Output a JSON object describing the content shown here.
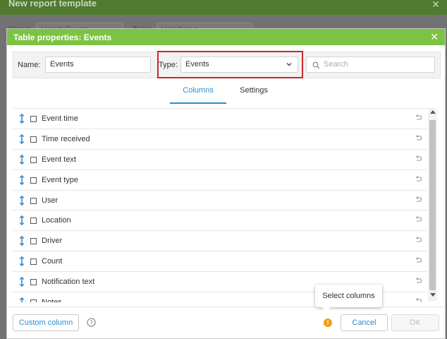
{
  "background_window": {
    "title": "New report template",
    "name_label": "Name:",
    "name_value": "Unsub Events",
    "type_label": "Type:",
    "type_value": "Unit Group"
  },
  "dialog": {
    "title": "Table properties: Events",
    "close_glyph": "✕"
  },
  "toolbar": {
    "name_label": "Name:",
    "name_value": "Events",
    "type_label": "Type:",
    "type_value": "Events",
    "search_placeholder": "Search"
  },
  "tabs": [
    {
      "label": "Columns",
      "active": true
    },
    {
      "label": "Settings",
      "active": false
    }
  ],
  "columns": [
    {
      "label": "Event time",
      "checked": false
    },
    {
      "label": "Time received",
      "checked": false
    },
    {
      "label": "Event text",
      "checked": false
    },
    {
      "label": "Event type",
      "checked": false
    },
    {
      "label": "User",
      "checked": false
    },
    {
      "label": "Location",
      "checked": false
    },
    {
      "label": "Driver",
      "checked": false
    },
    {
      "label": "Count",
      "checked": false
    },
    {
      "label": "Notification text",
      "checked": false
    },
    {
      "label": "Notes",
      "checked": false
    }
  ],
  "footer": {
    "custom_column_label": "Custom column",
    "help_glyph": "?",
    "warning_glyph": "!",
    "tooltip_text": "Select columns",
    "cancel_label": "Cancel",
    "ok_label": "OK"
  },
  "colors": {
    "header_green": "#7cc243",
    "accent_blue": "#2e8cd1",
    "highlight_red": "#c8272d",
    "warning_orange": "#f39c12"
  }
}
